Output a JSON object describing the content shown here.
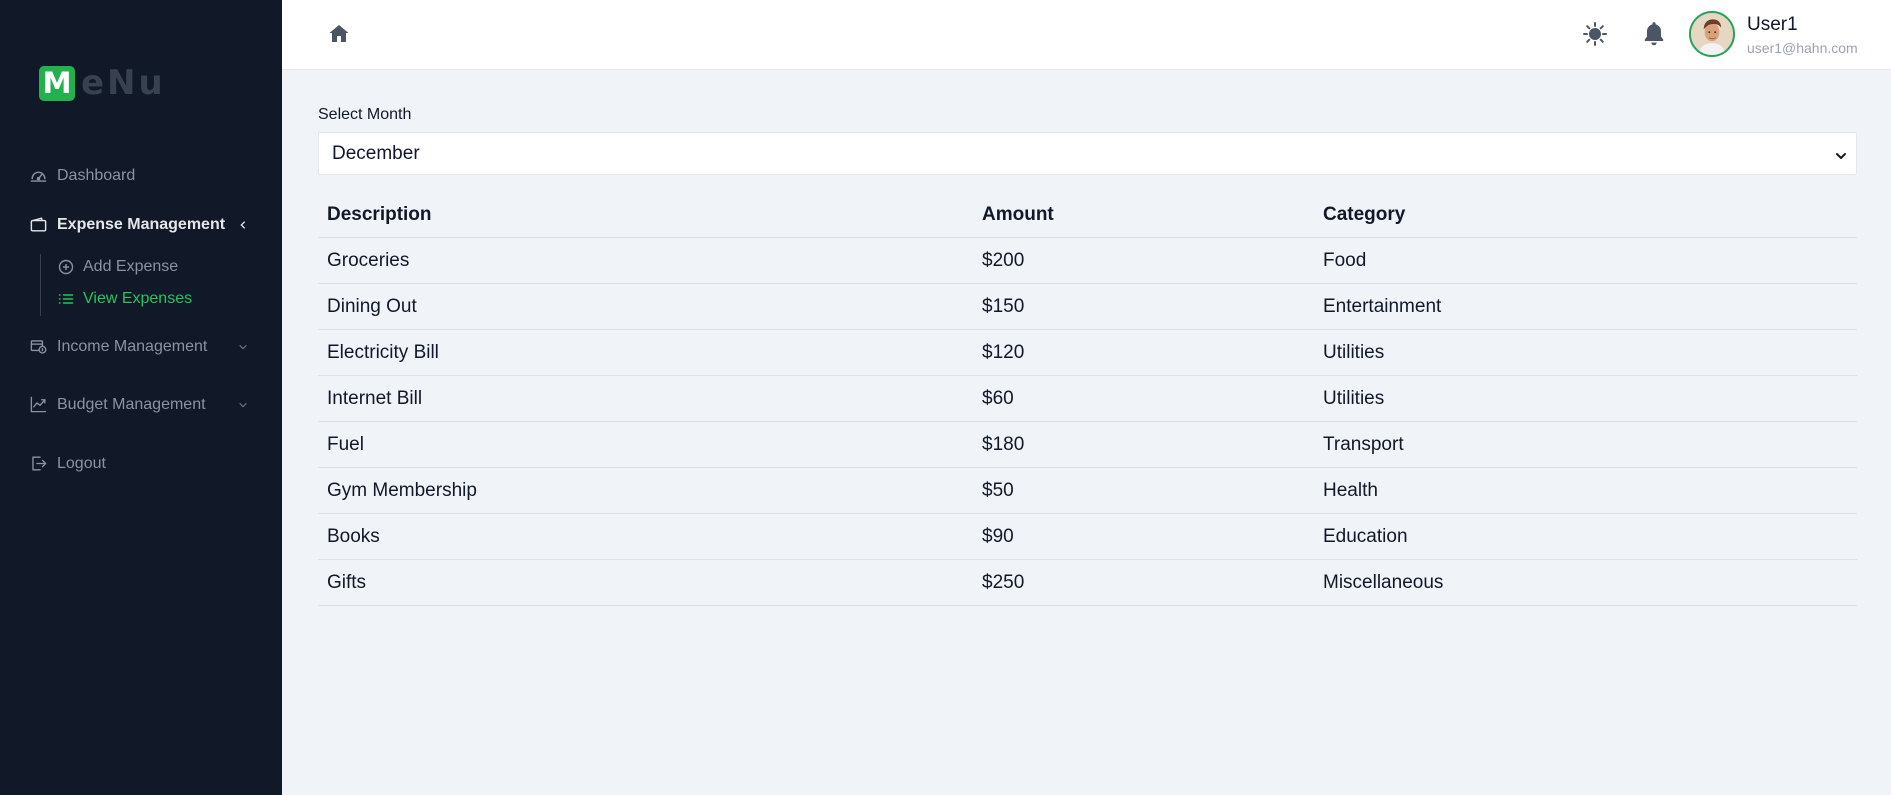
{
  "sidebar": {
    "logo_letter": "M",
    "logo_rest": "eNu",
    "items": [
      {
        "label": "Dashboard",
        "icon": "gauge-icon"
      },
      {
        "label": "Expense Management",
        "icon": "wallet-icon",
        "expanded": true
      },
      {
        "label": "Income Management",
        "icon": "income-icon"
      },
      {
        "label": "Budget Management",
        "icon": "chart-line-icon"
      },
      {
        "label": "Logout",
        "icon": "logout-icon"
      }
    ],
    "sub_items": [
      {
        "label": "Add Expense",
        "icon": "plus-circle-icon"
      },
      {
        "label": "View Expenses",
        "icon": "list-icon",
        "active": true
      }
    ]
  },
  "topbar": {
    "user_name": "User1",
    "user_email": "user1@hahn.com"
  },
  "main": {
    "select_label": "Select Month",
    "selected_month": "December",
    "columns": [
      "Description",
      "Amount",
      "Category"
    ],
    "rows": [
      [
        "Groceries",
        "$200",
        "Food"
      ],
      [
        "Dining Out",
        "$150",
        "Entertainment"
      ],
      [
        "Electricity Bill",
        "$120",
        "Utilities"
      ],
      [
        "Internet Bill",
        "$60",
        "Utilities"
      ],
      [
        "Fuel",
        "$180",
        "Transport"
      ],
      [
        "Gym Membership",
        "$50",
        "Health"
      ],
      [
        "Books",
        "$90",
        "Education"
      ],
      [
        "Gifts",
        "$250",
        "Miscellaneous"
      ]
    ]
  },
  "colors": {
    "sidebar_bg": "#111827",
    "accent_green": "#22c55e",
    "logo_green": "#22b14c",
    "content_bg": "#f0f3f8"
  }
}
